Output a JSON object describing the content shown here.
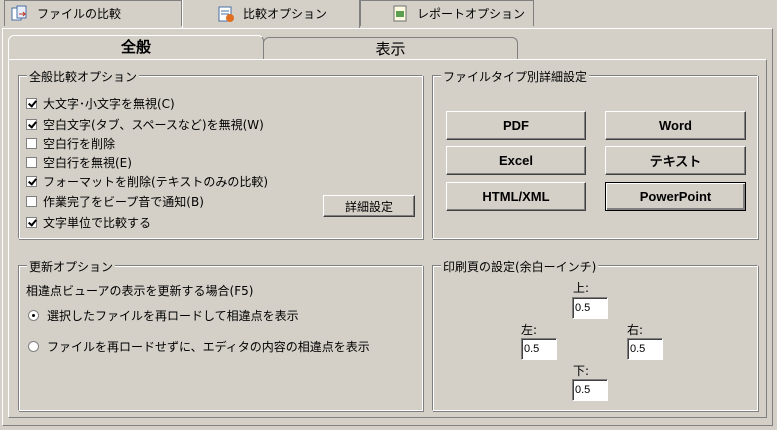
{
  "top_tabs": [
    {
      "label": "ファイルの比較"
    },
    {
      "label": "比較オプション"
    },
    {
      "label": "レポートオプション"
    }
  ],
  "sub_tabs": [
    {
      "label": "全般"
    },
    {
      "label": "表示"
    }
  ],
  "general": {
    "legend": "全般比較オプション",
    "options": [
      {
        "label": "大文字･小文字を無視(C)",
        "checked": true
      },
      {
        "label": "空白文字(タブ、スペースなど)を無視(W)",
        "checked": true
      },
      {
        "label": "空白行を削除",
        "checked": false
      },
      {
        "label": "空白行を無視(E)",
        "checked": false
      },
      {
        "label": "フォーマットを削除(テキストのみの比較)",
        "checked": true
      },
      {
        "label": "作業完了をビープ音で通知(B)",
        "checked": false
      },
      {
        "label": "文字単位で比較する",
        "checked": true
      }
    ],
    "detail_button": "詳細設定"
  },
  "filetype": {
    "legend": "ファイルタイプ別詳細設定",
    "buttons": [
      "PDF",
      "Word",
      "Excel",
      "テキスト",
      "HTML/XML",
      "PowerPoint"
    ]
  },
  "refresh": {
    "legend": "更新オプション",
    "description": "相違点ビューアの表示を更新する場合(F5)",
    "options": [
      {
        "label": "選択したファイルを再ロードして相違点を表示",
        "selected": true
      },
      {
        "label": "ファイルを再ロードせずに、エディタの内容の相違点を表示",
        "selected": false
      }
    ]
  },
  "print": {
    "legend": "印刷頁の設定(余白ーインチ)",
    "top_label": "上:",
    "top_value": "0.5",
    "left_label": "左:",
    "left_value": "0.5",
    "right_label": "右:",
    "right_value": "0.5",
    "bottom_label": "下:",
    "bottom_value": "0.5"
  }
}
